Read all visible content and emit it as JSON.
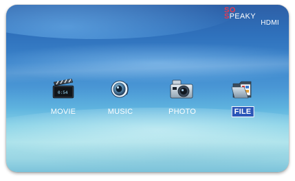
{
  "logo": {
    "line1": "SO",
    "line2_initial": "S",
    "line2_rest": "PEAKY",
    "line3": "HDMI"
  },
  "menu": {
    "items": [
      {
        "label": "MOVIE",
        "icon": "film-clapper-icon",
        "clock": "0:54"
      },
      {
        "label": "MUSIC",
        "icon": "speaker-icon"
      },
      {
        "label": "PHOTO",
        "icon": "camera-icon"
      },
      {
        "label": "FILE",
        "icon": "folder-icon"
      }
    ],
    "selected": "FILE"
  },
  "colors": {
    "background_top": "#2d5fa6",
    "background_bottom": "#a9e1ea",
    "logo_accent": "#e23b55",
    "label_text": "#ffffff",
    "selected_bg": "#2a55b8"
  }
}
